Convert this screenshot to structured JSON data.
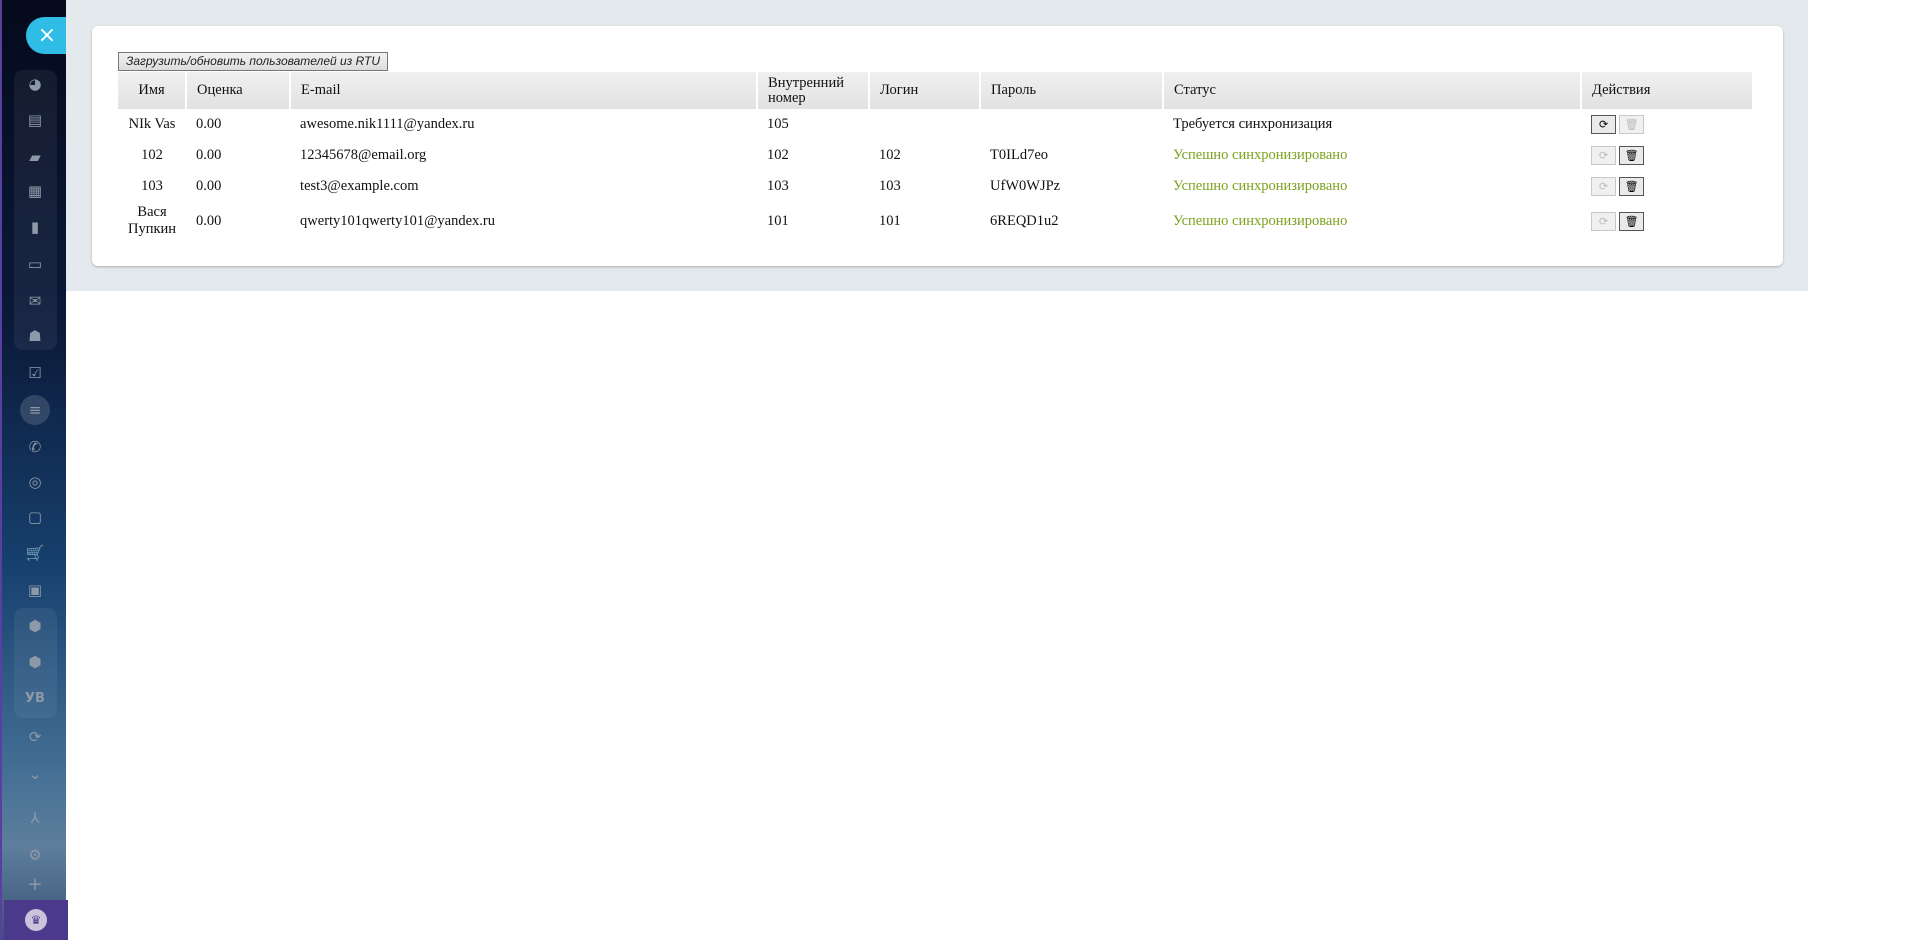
{
  "sidebar": {
    "close_icon": "×",
    "icons": [
      "dashboard-icon",
      "feed-icon",
      "chat-icon",
      "calendar-icon",
      "document-icon",
      "drive-icon",
      "mail-icon",
      "groups-icon",
      "tasks-icon",
      "crm-funnel-icon",
      "phone-icon",
      "target-icon",
      "sites-icon",
      "shop-icon",
      "contact-card-icon",
      "box-icon",
      "box-icon",
      "yb-app-icon",
      "sync-icon",
      "chevron-down-icon",
      "hierarchy-icon",
      "settings-icon",
      "add-icon",
      "crown-icon"
    ],
    "app_label": "УВ"
  },
  "toolbar": {
    "load_button": "Загрузить/обновить пользователей из RTU"
  },
  "table": {
    "headers": {
      "name": "Имя",
      "rating": "Оценка",
      "email": "E-mail",
      "ext_l1": "Внутренний",
      "ext_l2": "номер",
      "login": "Логин",
      "password": "Пароль",
      "status": "Статус",
      "actions": "Действия"
    },
    "rows": [
      {
        "name": "NIk Vas",
        "rating": "0.00",
        "email": "awesome.nik1111@yandex.ru",
        "ext": "105",
        "login": "",
        "password": "",
        "status": "Требуется синхронизация",
        "status_ok": false
      },
      {
        "name": "102",
        "rating": "0.00",
        "email": "12345678@email.org",
        "ext": "102",
        "login": "102",
        "password": "T0ILd7eo",
        "status": "Успешно синхронизировано",
        "status_ok": true
      },
      {
        "name": "103",
        "rating": "0.00",
        "email": "test3@example.com",
        "ext": "103",
        "login": "103",
        "password": "UfW0WJPz",
        "status": "Успешно синхронизировано",
        "status_ok": true
      },
      {
        "name": "Вася Пупкин",
        "rating": "0.00",
        "email": "qwerty101qwerty101@yandex.ru",
        "ext": "101",
        "login": "101",
        "password": "6REQD1u2",
        "status": "Успешно синхронизировано",
        "status_ok": true
      }
    ]
  },
  "colors": {
    "accent": "#2fbde8",
    "success": "#7aa21d",
    "panel_bg": "#e3e9ec"
  }
}
